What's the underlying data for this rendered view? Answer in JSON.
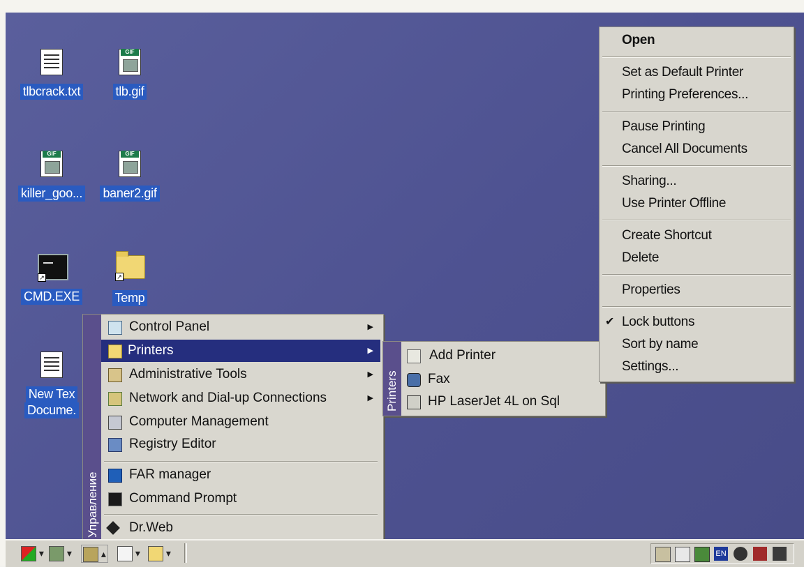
{
  "desktop": {
    "icons": [
      {
        "label": "tlbcrack.txt",
        "icon": "text-file-icon"
      },
      {
        "label": "tlb.gif",
        "icon": "gif-file-icon"
      },
      {
        "label": "killer_goo...",
        "icon": "gif-file-icon"
      },
      {
        "label": "baner2.gif",
        "icon": "gif-file-icon"
      },
      {
        "label": "CMD.EXE",
        "icon": "cmd-shortcut-icon"
      },
      {
        "label": "Temp",
        "icon": "folder-shortcut-icon"
      },
      {
        "label_line1": "New Tex",
        "label_line2": "Docume.",
        "icon": "text-file-icon"
      }
    ]
  },
  "quicklaunch_menu": {
    "band_label": "Управление",
    "items": [
      {
        "label": "Control Panel",
        "icon": "control-panel-icon",
        "has_submenu": true
      },
      {
        "label": "Printers",
        "icon": "printers-folder-icon",
        "has_submenu": true,
        "highlighted": true
      },
      {
        "label": "Administrative Tools",
        "icon": "admin-tools-icon",
        "has_submenu": true
      },
      {
        "label": "Network and Dial-up Connections",
        "icon": "network-icon",
        "has_submenu": true
      },
      {
        "label": "Computer Management",
        "icon": "computer-management-icon"
      },
      {
        "label": "Registry Editor",
        "icon": "registry-editor-icon"
      },
      {
        "label": "FAR manager",
        "icon": "far-manager-icon"
      },
      {
        "label": "Command Prompt",
        "icon": "command-prompt-icon"
      },
      {
        "label": "Dr.Web",
        "icon": "drweb-icon"
      }
    ]
  },
  "printers_submenu": {
    "band_label": "Printers",
    "items": [
      {
        "label": "Add Printer",
        "icon": "add-printer-icon"
      },
      {
        "label": "Fax",
        "icon": "fax-icon"
      },
      {
        "label": "HP LaserJet 4L on Sql",
        "icon": "printer-icon"
      }
    ]
  },
  "context_menu": {
    "items": [
      {
        "label": "Open",
        "bold": true
      },
      {
        "label": "Set as Default Printer"
      },
      {
        "label": "Printing Preferences..."
      },
      {
        "label": "Pause Printing"
      },
      {
        "label": "Cancel All Documents"
      },
      {
        "label": "Sharing..."
      },
      {
        "label": "Use Printer Offline"
      },
      {
        "label": "Create Shortcut"
      },
      {
        "label": "Delete"
      },
      {
        "label": "Properties"
      },
      {
        "label": "Lock buttons",
        "checked": true
      },
      {
        "label": "Sort by name"
      },
      {
        "label": "Settings..."
      }
    ],
    "check_mark": "✔"
  },
  "taskbar": {
    "toolbars": [
      {
        "icon": "start-flag-icon"
      },
      {
        "icon": "people-icon"
      },
      {
        "icon": "network-icon"
      },
      {
        "icon": "window-icon"
      },
      {
        "icon": "folder-icon"
      }
    ],
    "arrow_down": "▾",
    "arrow_up": "▴",
    "tray": {
      "language": "EN",
      "icons": [
        "volume-icon",
        "network-status-icon",
        "app-icon",
        "language-icon",
        "eye-icon",
        "shield-icon",
        "antivirus-icon"
      ]
    }
  },
  "colors": {
    "desktop": "#4e5291",
    "highlight": "#252e7e",
    "menu_bg": "#d9d7cf",
    "band": "#5a4f8c"
  }
}
